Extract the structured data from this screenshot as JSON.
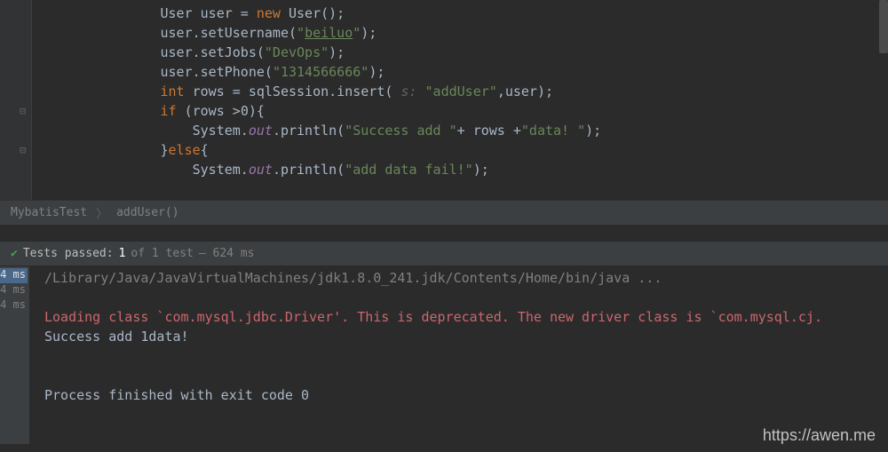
{
  "code": {
    "indent": "        ",
    "lines": [
      {
        "segments": [
          {
            "t": "User ",
            "c": "type"
          },
          {
            "t": "user = ",
            "c": "plain"
          },
          {
            "t": "new ",
            "c": "kw"
          },
          {
            "t": "User();",
            "c": "plain"
          }
        ]
      },
      {
        "segments": [
          {
            "t": "user.setUsername(",
            "c": "plain"
          },
          {
            "t": "\"",
            "c": "str"
          },
          {
            "t": "beiluo",
            "c": "str underline"
          },
          {
            "t": "\"",
            "c": "str"
          },
          {
            "t": ");",
            "c": "plain"
          }
        ]
      },
      {
        "segments": [
          {
            "t": "user.setJobs(",
            "c": "plain"
          },
          {
            "t": "\"DevOps\"",
            "c": "str"
          },
          {
            "t": ");",
            "c": "plain"
          }
        ]
      },
      {
        "segments": [
          {
            "t": "user.setPhone(",
            "c": "plain"
          },
          {
            "t": "\"1314566666\"",
            "c": "str"
          },
          {
            "t": ");",
            "c": "plain"
          }
        ]
      },
      {
        "segments": [
          {
            "t": "int ",
            "c": "kw"
          },
          {
            "t": "rows = sqlSession.insert( ",
            "c": "plain"
          },
          {
            "t": "s: ",
            "c": "hint"
          },
          {
            "t": "\"addUser\"",
            "c": "str"
          },
          {
            "t": ",user);",
            "c": "plain"
          }
        ]
      },
      {
        "segments": [
          {
            "t": "if ",
            "c": "kw"
          },
          {
            "t": "(rows >",
            "c": "plain"
          },
          {
            "t": "0",
            "c": "plain"
          },
          {
            "t": "){",
            "c": "plain"
          }
        ]
      },
      {
        "segments": [
          {
            "t": "    System.",
            "c": "plain"
          },
          {
            "t": "out",
            "c": "field"
          },
          {
            "t": ".println(",
            "c": "plain"
          },
          {
            "t": "\"Success add \"",
            "c": "str"
          },
          {
            "t": "+ rows +",
            "c": "plain"
          },
          {
            "t": "\"data! \"",
            "c": "str"
          },
          {
            "t": ");",
            "c": "plain"
          }
        ]
      },
      {
        "segments": [
          {
            "t": "}",
            "c": "plain"
          },
          {
            "t": "else",
            "c": "kw"
          },
          {
            "t": "{",
            "c": "plain"
          }
        ]
      },
      {
        "segments": [
          {
            "t": "    System.",
            "c": "plain"
          },
          {
            "t": "out",
            "c": "field"
          },
          {
            "t": ".println(",
            "c": "plain"
          },
          {
            "t": "\"add data fail!\"",
            "c": "str"
          },
          {
            "t": ");",
            "c": "plain"
          }
        ]
      }
    ]
  },
  "breadcrumb": {
    "class": "MybatisTest",
    "method": "addUser()"
  },
  "tests": {
    "passed_label": "Tests passed:",
    "passed_count": "1",
    "of_label": "of 1 test",
    "duration": "– 624 ms"
  },
  "timings": [
    "4 ms",
    "4 ms",
    "4 ms"
  ],
  "console": {
    "cmd": "/Library/Java/JavaVirtualMachines/jdk1.8.0_241.jdk/Contents/Home/bin/java ...",
    "blank1": "",
    "warn": "Loading class `com.mysql.jdbc.Driver'. This is deprecated. The new driver class is `com.mysql.cj.",
    "out1": "Success add 1data! ",
    "blank2": "",
    "blank3": "",
    "exit": "Process finished with exit code 0"
  },
  "watermark": "https://awen.me"
}
